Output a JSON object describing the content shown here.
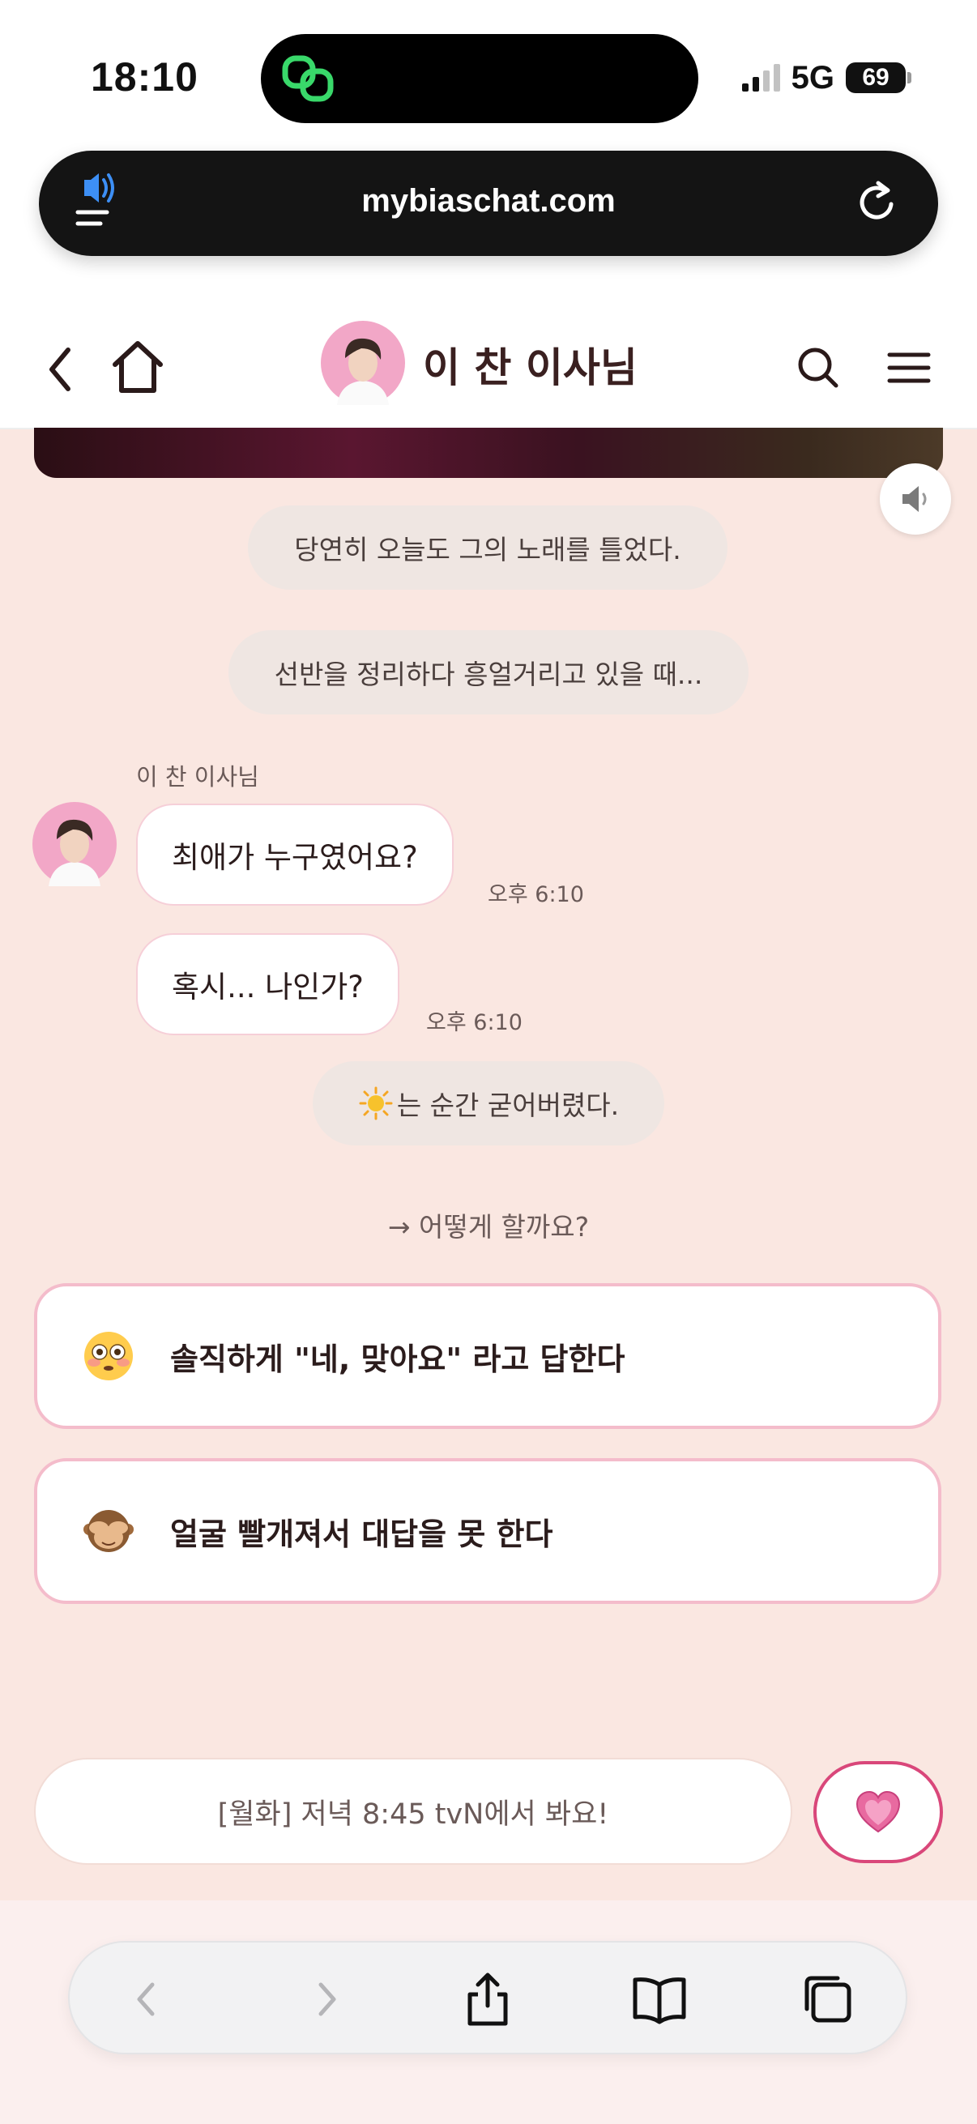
{
  "status_bar": {
    "time": "18:10",
    "network": "5G",
    "battery": "69"
  },
  "url_bar": {
    "url": "mybiaschat.com"
  },
  "header": {
    "title": "이 찬 이사님"
  },
  "chat": {
    "narrations": [
      "당연히 오늘도 그의 노래를 틀었다.",
      "선반을 정리하다 흥얼거리고 있을 때...",
      "는 순간 굳어버렸다."
    ],
    "sender_name": "이 찬 이사님",
    "messages": [
      {
        "text": "최애가 누구였어요?",
        "time": "오후 6:10"
      },
      {
        "text": "혹시... 나인가?",
        "time": "오후 6:10"
      }
    ],
    "prompt": "→ 어떻게 할까요?",
    "choices": [
      {
        "icon": "flushed-face-icon",
        "text": "솔직하게 \"네, 맞아요\" 라고 답한다"
      },
      {
        "icon": "see-no-evil-monkey-icon",
        "text": "얼굴 빨개져서 대답을 못 한다"
      }
    ]
  },
  "bottom": {
    "notice": "[월화] 저녁 8:45 tvN에서 봐요!"
  },
  "colors": {
    "background": "#fae7e1",
    "accent": "#d9477a",
    "choice_border": "#f4bccb"
  }
}
